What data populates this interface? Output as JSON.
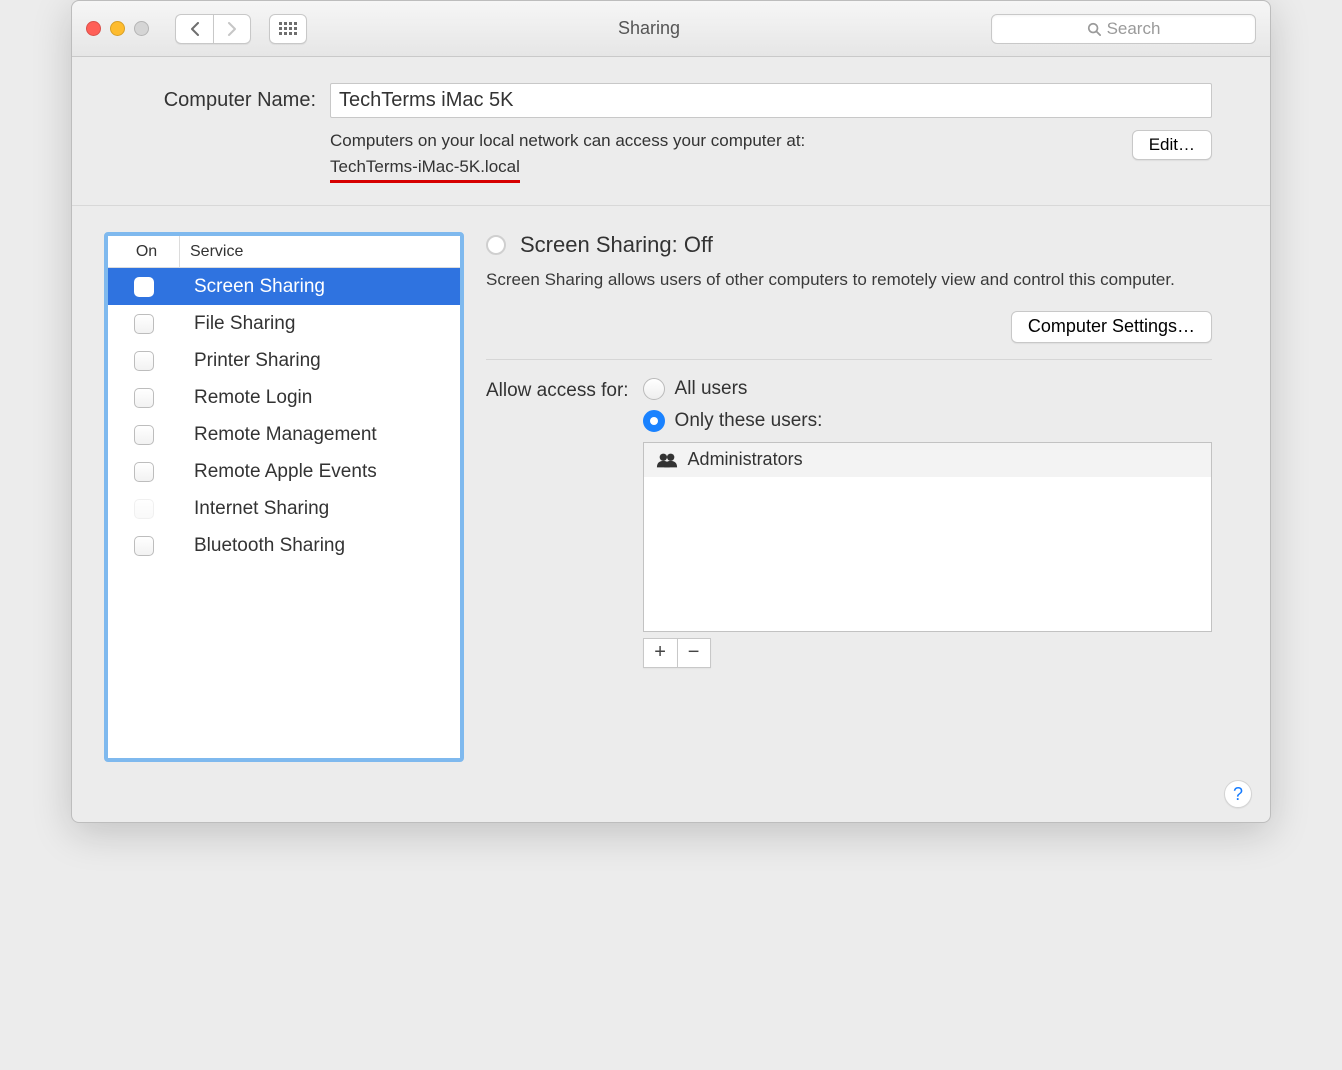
{
  "titlebar": {
    "title": "Sharing",
    "search_placeholder": "Search"
  },
  "header": {
    "computer_name_label": "Computer Name:",
    "computer_name_value": "TechTerms iMac 5K",
    "hint_line1": "Computers on your local network can access your computer at:",
    "hostname": "TechTerms-iMac-5K.local",
    "edit_label": "Edit…"
  },
  "list": {
    "col_on": "On",
    "col_service": "Service",
    "items": [
      {
        "label": "Screen Sharing",
        "checked": false,
        "selected": true,
        "dim": false
      },
      {
        "label": "File Sharing",
        "checked": false,
        "selected": false,
        "dim": false
      },
      {
        "label": "Printer Sharing",
        "checked": false,
        "selected": false,
        "dim": false
      },
      {
        "label": "Remote Login",
        "checked": false,
        "selected": false,
        "dim": false
      },
      {
        "label": "Remote Management",
        "checked": false,
        "selected": false,
        "dim": false
      },
      {
        "label": "Remote Apple Events",
        "checked": false,
        "selected": false,
        "dim": false
      },
      {
        "label": "Internet Sharing",
        "checked": false,
        "selected": false,
        "dim": true
      },
      {
        "label": "Bluetooth Sharing",
        "checked": false,
        "selected": false,
        "dim": false
      }
    ]
  },
  "detail": {
    "title": "Screen Sharing: Off",
    "desc": "Screen Sharing allows users of other computers to remotely view and control this computer.",
    "computer_settings_label": "Computer Settings…",
    "access_label": "Allow access for:",
    "radio_all": "All users",
    "radio_only": "Only these users:",
    "user_list": [
      "Administrators"
    ],
    "plus": "+",
    "minus": "−"
  },
  "footer": {
    "help": "?"
  }
}
